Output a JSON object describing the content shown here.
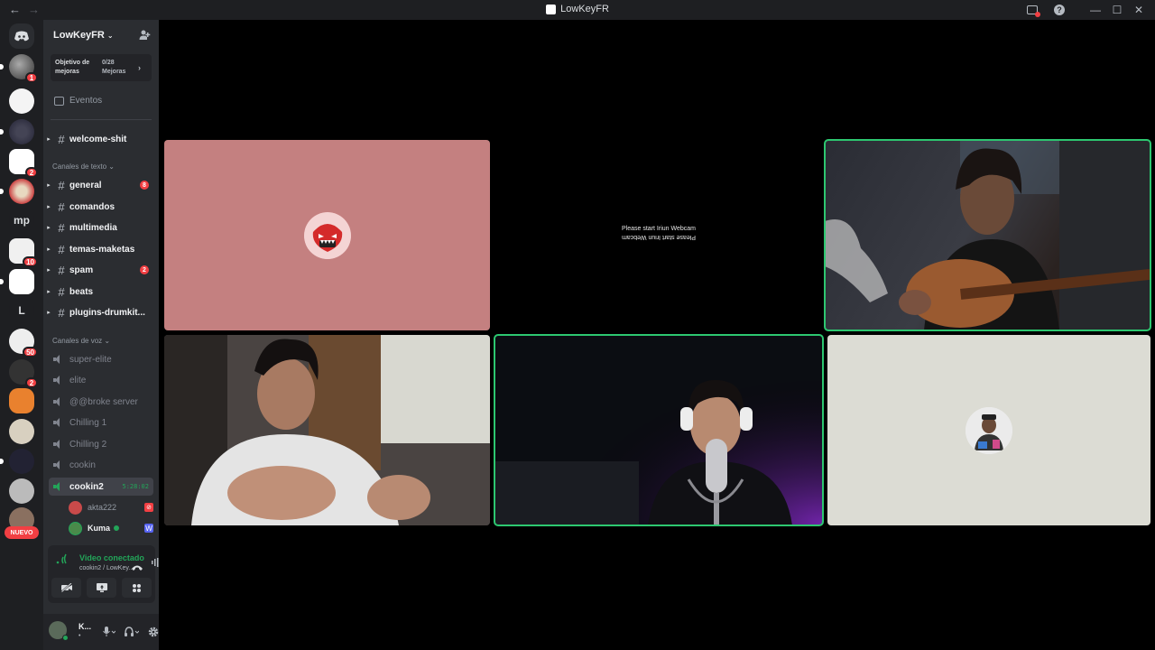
{
  "window": {
    "title": "LowKeyFR",
    "back_icon": "arrow-left",
    "forward_icon": "arrow-right"
  },
  "guild_bar": {
    "badges": [
      "1",
      "2",
      "10",
      "50",
      "2"
    ],
    "text_servers": [
      "mp",
      "L"
    ],
    "new_label": "NUEVO"
  },
  "server": {
    "name": "LowKeyFR",
    "boost": {
      "goal_label": "Objetivo de mejoras",
      "progress": "0/28",
      "progress_label": "Mejoras"
    },
    "events_label": "Eventos",
    "top_channel": "welcome-shit",
    "text_category": "Canales de texto",
    "text_channels": [
      {
        "name": "general",
        "badge": "8"
      },
      {
        "name": "comandos",
        "badge": ""
      },
      {
        "name": "multimedia",
        "badge": ""
      },
      {
        "name": "temas-maketas",
        "badge": ""
      },
      {
        "name": "spam",
        "badge": "2"
      },
      {
        "name": "beats",
        "badge": ""
      },
      {
        "name": "plugins-drumkit...",
        "badge": ""
      }
    ],
    "voice_category": "Canales de voz",
    "voice_channels": [
      {
        "name": "super-elite"
      },
      {
        "name": "elite"
      },
      {
        "name": "@@broke server"
      },
      {
        "name": "Chilling 1"
      },
      {
        "name": "Chilling 2"
      },
      {
        "name": "cookin"
      },
      {
        "name": "cookin2",
        "timer": "5:28:02",
        "active": true
      }
    ],
    "voice_users": [
      {
        "name": "akta222",
        "color": "#c94a4a"
      },
      {
        "name": "Kuma",
        "color": "#4a8a4a"
      }
    ]
  },
  "voice_panel": {
    "status": "Video conectado",
    "channel": "cookin2 / LowKey..."
  },
  "user": {
    "name": "K...",
    "status": "•"
  },
  "video_tiles": {
    "webcam_message": "Please start Iriun Webcam",
    "tile1_bg": "#c48080",
    "tile6_bg": "#dcdcd4"
  },
  "colors": {
    "accent_green": "#23a559",
    "badge_red": "#f23f43",
    "sidebar_bg": "#2b2d31",
    "guild_bg": "#1e1f22"
  }
}
